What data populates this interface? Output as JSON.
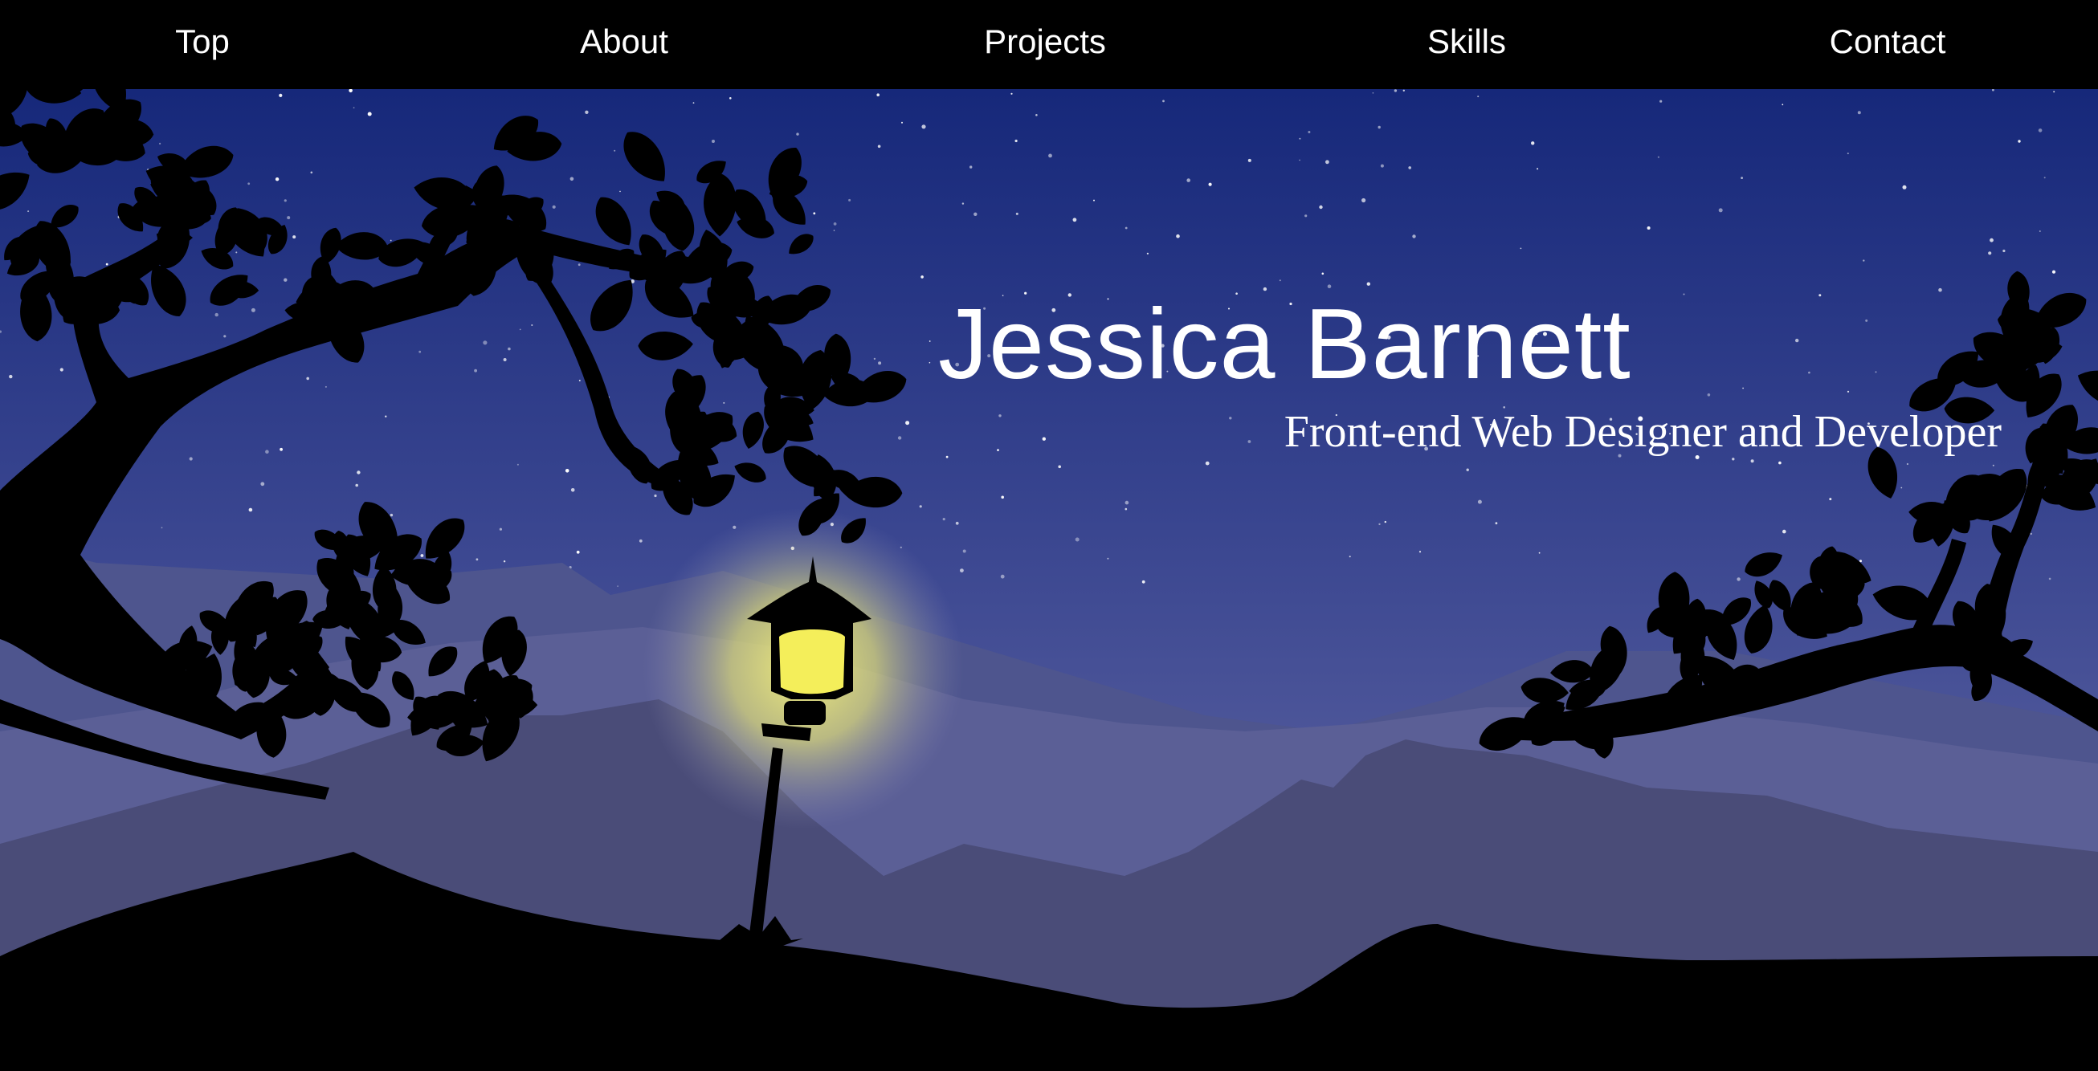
{
  "nav": {
    "items": [
      {
        "label": "Top"
      },
      {
        "label": "About"
      },
      {
        "label": "Projects"
      },
      {
        "label": "Skills"
      },
      {
        "label": "Contact"
      }
    ]
  },
  "hero": {
    "title": "Jessica Barnett",
    "subtitle": "Front-end Web Designer and Developer"
  },
  "colors": {
    "sky_top": "#172a7a",
    "sky_bottom": "#6468a4",
    "lamp_glow": "#f4f07a",
    "silhouette": "#000000"
  },
  "icons": [
    "street-lamp-icon"
  ]
}
